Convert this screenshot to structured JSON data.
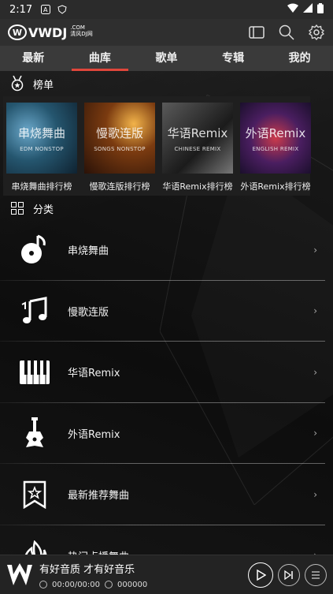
{
  "status_bar": {
    "time": "2:17",
    "icons": [
      "a-icon",
      "shield-icon",
      "wifi-icon",
      "signal-icon",
      "battery-icon"
    ]
  },
  "app_bar": {
    "logo_text": "VWDJ",
    "logo_suffix": ".COM",
    "logo_sub": "清风DJ网",
    "actions": [
      "tablet-icon",
      "search-icon",
      "settings-icon"
    ]
  },
  "tabs": [
    {
      "label": "最新",
      "active": false
    },
    {
      "label": "曲库",
      "active": true
    },
    {
      "label": "歌单",
      "active": false
    },
    {
      "label": "专辑",
      "active": false
    },
    {
      "label": "我的",
      "active": false
    }
  ],
  "charts_section": {
    "title": "榜单",
    "items": [
      {
        "thumb_title": "串烧舞曲",
        "thumb_sub": "EDM NONSTOP",
        "caption": "串烧舞曲排行榜"
      },
      {
        "thumb_title": "慢歌连版",
        "thumb_sub": "SONGS NONSTOP",
        "caption": "慢歌连版排行榜"
      },
      {
        "thumb_title": "华语Remix",
        "thumb_sub": "CHINESE REMIX",
        "caption": "华语Remix排行榜"
      },
      {
        "thumb_title": "外语Remix",
        "thumb_sub": "ENGLISH REMIX",
        "caption": "外语Remix排行榜"
      }
    ]
  },
  "categories_section": {
    "title": "分类",
    "items": [
      {
        "label": "串烧舞曲",
        "icon": "vinyl-note-icon"
      },
      {
        "label": "慢歌连版",
        "icon": "music-notes-icon"
      },
      {
        "label": "华语Remix",
        "icon": "piano-icon"
      },
      {
        "label": "外语Remix",
        "icon": "guitar-icon"
      },
      {
        "label": "最新推荐舞曲",
        "icon": "star-bookmark-icon"
      },
      {
        "label": "热门点播舞曲",
        "icon": "flame-icon"
      }
    ],
    "chevron": "›"
  },
  "player": {
    "title": "有好音质 才有好音乐",
    "time": "00:00/00:00",
    "count": "000000"
  }
}
